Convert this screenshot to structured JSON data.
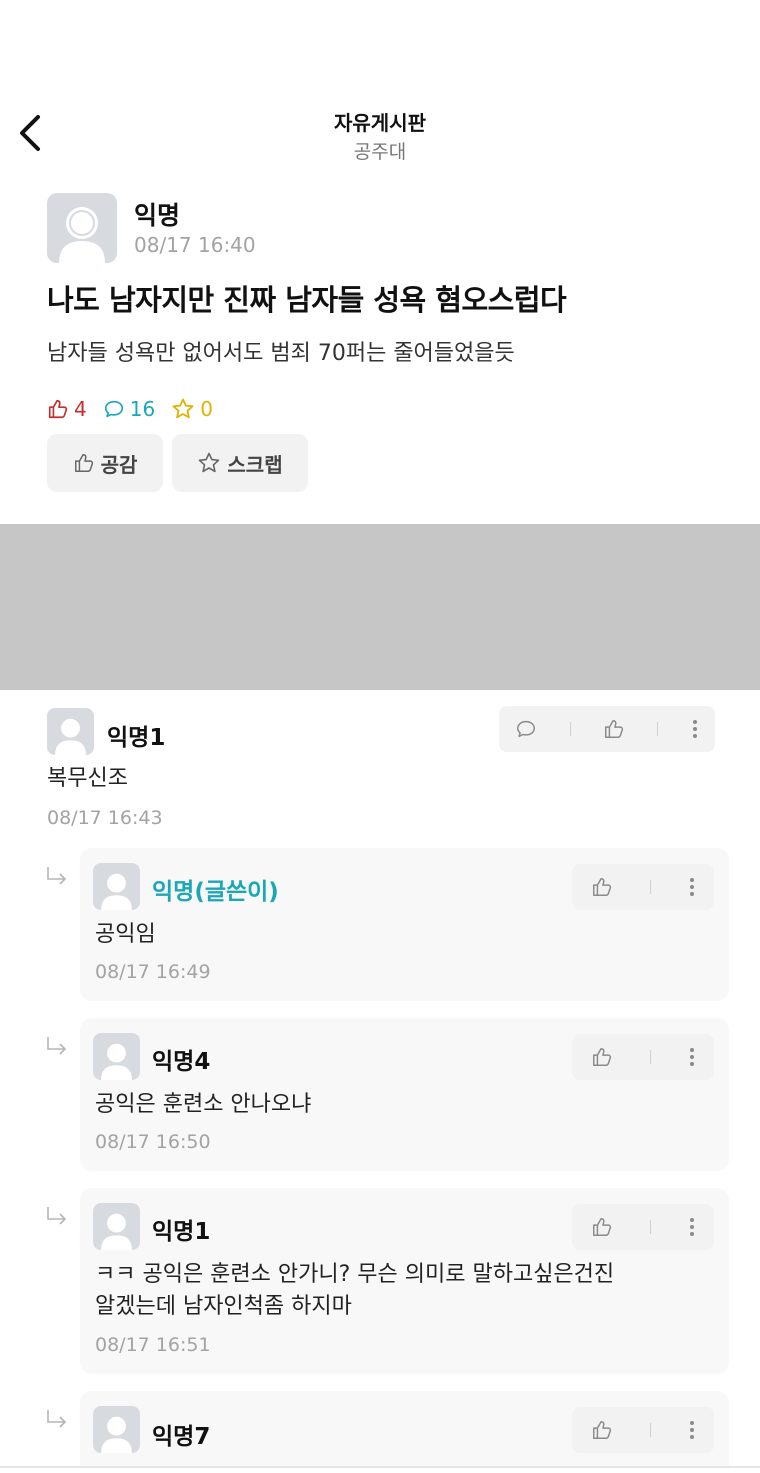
{
  "header": {
    "title": "자유게시판",
    "subtitle": "공주대"
  },
  "post": {
    "author": "익명",
    "date": "08/17 16:40",
    "title": "나도 남자지만 진짜 남자들 성욕 혐오스럽다",
    "body": "남자들 성욕만 없어서도 범죄 70퍼는 줄어들었을듯",
    "likes": "4",
    "comments": "16",
    "scraps": "0",
    "like_button": "공감",
    "scrap_button": "스크랩",
    "colors": {
      "like": "#c62e2e",
      "comment": "#1aa7b8",
      "scrap": "#e2b100"
    }
  },
  "comments": [
    {
      "author": "익명1",
      "text": "복무신조",
      "date": "08/17 16:43",
      "replies": [
        {
          "author": "익명(글쓴이)",
          "text": "공익임",
          "date": "08/17 16:49",
          "is_op": true
        },
        {
          "author": "익명4",
          "text": "공익은 훈련소 안나오냐",
          "date": "08/17 16:50"
        },
        {
          "author": "익명1",
          "text_line1": "ㅋㅋ 공익은 훈련소 안가니? 무슨 의미로 말하고싶은건진",
          "text_line2": "알겠는데 남자인척좀 하지마",
          "date": "08/17 16:51"
        },
        {
          "author": "익명7"
        }
      ]
    }
  ]
}
